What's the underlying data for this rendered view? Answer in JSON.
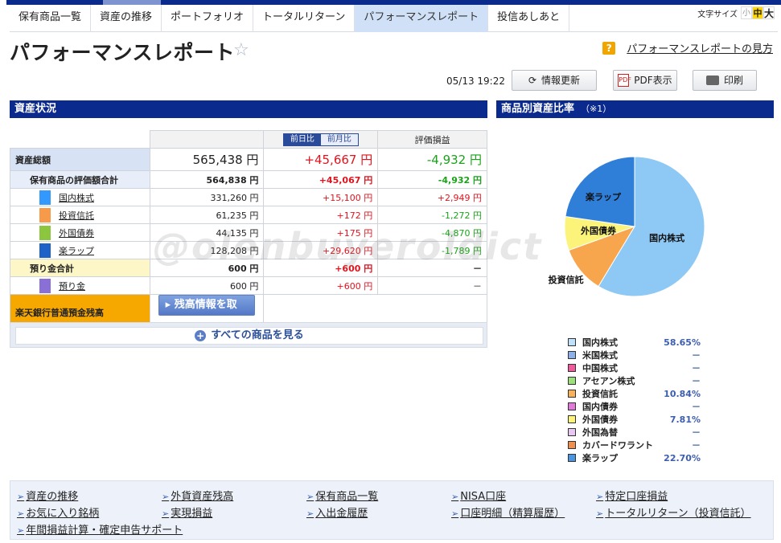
{
  "nav": {
    "tabs": [
      "保有商品一覧",
      "資産の推移",
      "ポートフォリオ",
      "トータルリターン",
      "パフォーマンスレポート",
      "投信あしあと"
    ],
    "active_index": 4,
    "font_size_label": "文字サイズ",
    "font_small": "小",
    "font_medium": "中",
    "font_large": "大"
  },
  "page": {
    "title": "パフォーマンスレポート",
    "help_icon": "?",
    "help_link": "パフォーマンスレポートの見方"
  },
  "toolbar": {
    "timestamp": "05/13 19:22",
    "refresh_label": "情報更新",
    "pdf_icon_text": "PDF",
    "pdf_label": "PDF表示",
    "print_label": "印刷"
  },
  "asset_section": {
    "title": "資産状況",
    "toggle_day": "前日比",
    "toggle_month": "前月比",
    "eval_header": "評価損益",
    "total": {
      "label": "資産総額",
      "value": "565,438 円",
      "change": "+45,667 円",
      "gain": "-4,932 円"
    },
    "holdings_total": {
      "label": "保有商品の評価額合計",
      "value": "564,838 円",
      "change": "+45,067 円",
      "gain": "-4,932 円"
    },
    "items": [
      {
        "name": "国内株式",
        "color": "#3399ff",
        "value": "331,260 円",
        "change": "+15,100 円",
        "gain": "+2,949 円",
        "gain_sign": "pos"
      },
      {
        "name": "投資信託",
        "color": "#f79a4a",
        "value": "61,235 円",
        "change": "+172 円",
        "gain": "-1,272 円",
        "gain_sign": "neg"
      },
      {
        "name": "外国債券",
        "color": "#8cc63f",
        "value": "44,135 円",
        "change": "+175 円",
        "gain": "-4,870 円",
        "gain_sign": "neg"
      },
      {
        "name": "楽ラップ",
        "color": "#1e62c8",
        "value": "128,208 円",
        "change": "+29,620 円",
        "gain": "-1,789 円",
        "gain_sign": "neg"
      }
    ],
    "cash_total": {
      "label": "預り金合計",
      "value": "600 円",
      "change": "+600 円",
      "gain": "－"
    },
    "cash_item": {
      "name": "預り金",
      "color": "#8a6fd6",
      "value": "600 円",
      "change": "+600 円",
      "gain": "－"
    },
    "bank": {
      "label": "楽天銀行普通預金残高",
      "button": "残高情報を取得"
    },
    "see_all": "すべての商品を見る"
  },
  "ratio_section": {
    "title": "商品別資産比率",
    "note": "（※1）"
  },
  "chart_data": {
    "type": "pie",
    "slices": [
      {
        "name": "国内株式",
        "value": 58.65,
        "color": "#8ec9f5"
      },
      {
        "name": "投資信託",
        "value": 10.84,
        "color": "#f7a64d"
      },
      {
        "name": "外国債券",
        "value": 7.81,
        "color": "#fbf37a"
      },
      {
        "name": "楽ラップ",
        "value": 22.7,
        "color": "#2f7fd9"
      }
    ],
    "labels": [
      "国内株式",
      "投資信託",
      "外国債券",
      "楽ラップ"
    ],
    "legend": [
      {
        "name": "国内株式",
        "value": "58.65%",
        "color": "#bfe1fb"
      },
      {
        "name": "米国株式",
        "value": "－",
        "color": "#8db0e8"
      },
      {
        "name": "中国株式",
        "value": "－",
        "color": "#f05a9a"
      },
      {
        "name": "アセアン株式",
        "value": "－",
        "color": "#9be07a"
      },
      {
        "name": "投資信託",
        "value": "10.84%",
        "color": "#f8b25a"
      },
      {
        "name": "国内債券",
        "value": "－",
        "color": "#e07ad8"
      },
      {
        "name": "外国債券",
        "value": "7.81%",
        "color": "#fbf37a"
      },
      {
        "name": "外国為替",
        "value": "－",
        "color": "#e8c8f0"
      },
      {
        "name": "カバードワラント",
        "value": "－",
        "color": "#f09050"
      },
      {
        "name": "楽ラップ",
        "value": "22.70%",
        "color": "#4a94e0"
      }
    ]
  },
  "bottom_links": [
    "資産の推移",
    "外貨資産残高",
    "保有商品一覧",
    "NISA口座",
    "特定口座損益",
    "お気に入り銘柄",
    "実現損益",
    "入出金履歴",
    "口座明細（精算履歴）",
    "トータルリターン（投資信託）",
    "年間損益計算・確定申告サポート"
  ],
  "watermark": "@olenbuyeroldict"
}
